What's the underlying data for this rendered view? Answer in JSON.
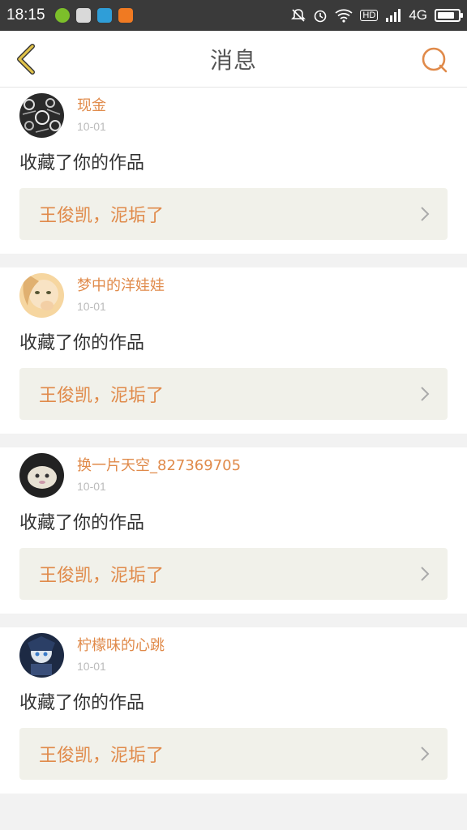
{
  "status_bar": {
    "time": "18:15",
    "network": "4G",
    "hd_label": "HD",
    "battery_level": 0.85
  },
  "header": {
    "title": "消息"
  },
  "messages": [
    {
      "username": "现金",
      "date": "10-01",
      "action": "收藏了你的作品",
      "work_title": "王俊凯，泥垢了"
    },
    {
      "username": "梦中的洋娃娃",
      "date": "10-01",
      "action": "收藏了你的作品",
      "work_title": "王俊凯，泥垢了"
    },
    {
      "username": "换一片天空_827369705",
      "date": "10-01",
      "action": "收藏了你的作品",
      "work_title": "王俊凯，泥垢了"
    },
    {
      "username": "柠檬味的心跳",
      "date": "10-01",
      "action": "收藏了你的作品",
      "work_title": "王俊凯，泥垢了"
    }
  ],
  "colors": {
    "accent": "#e08a4a",
    "back_icon": "#e0c24a"
  }
}
